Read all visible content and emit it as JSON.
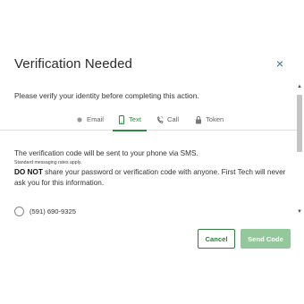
{
  "modal": {
    "title": "Verification Needed",
    "close_symbol": "×",
    "intro": "Please verify your identity before completing this action."
  },
  "tabs": [
    {
      "label": "Email",
      "icon": "dot-icon",
      "active": false
    },
    {
      "label": "Text",
      "icon": "mobile-phone-icon",
      "active": true
    },
    {
      "label": "Call",
      "icon": "phone-call-icon",
      "active": false
    },
    {
      "label": "Token",
      "icon": "lock-icon",
      "active": false
    }
  ],
  "content": {
    "sms_notice": "The verification code will be sent to your phone via SMS.",
    "rates_notice": "Standard messaging rates apply.",
    "warning_bold": "DO NOT",
    "warning_text": " share your password or verification code with anyone. First Tech will never ask you for this information.",
    "phone_option": "(591) 690-9325"
  },
  "buttons": {
    "cancel": "Cancel",
    "send": "Send Code"
  },
  "colors": {
    "accent_green": "#2e8b3f",
    "disabled_green": "#94c79c",
    "close_blue": "#2f6f9e"
  }
}
